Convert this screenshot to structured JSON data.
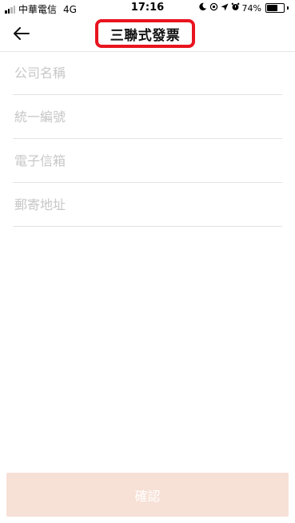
{
  "status_bar": {
    "carrier": "中華電信",
    "network": "4G",
    "time": "17:16",
    "battery_percent": "74%",
    "battery_level": 0.74,
    "icons": [
      "moon-icon",
      "orientation-lock-icon",
      "location-icon",
      "alarm-icon",
      "battery-icon"
    ]
  },
  "header": {
    "back_icon": "arrow-left-icon",
    "title": "三聯式發票",
    "highlight_color": "#e8141f"
  },
  "form": {
    "company_name": {
      "placeholder": "公司名稱",
      "value": ""
    },
    "tax_id": {
      "placeholder": "統一編號",
      "value": ""
    },
    "email": {
      "placeholder": "電子信箱",
      "value": ""
    },
    "address": {
      "placeholder": "郵寄地址",
      "value": ""
    }
  },
  "confirm": {
    "label": "確認",
    "background_color": "#f7e0d6"
  }
}
